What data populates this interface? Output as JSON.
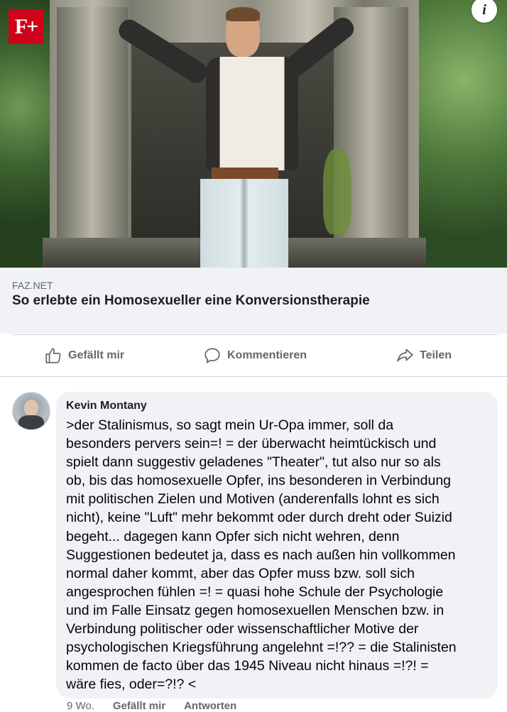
{
  "article": {
    "brand_badge": "F+",
    "info_icon_glyph": "i",
    "domain": "FAZ.NET",
    "title": "So erlebte ein Homosexueller eine Konversionstherapie"
  },
  "actions": {
    "like": "Gefällt mir",
    "comment": "Kommentieren",
    "share": "Teilen"
  },
  "comment": {
    "author": "Kevin Montany",
    "text": ">der Stalinismus, so sagt mein Ur-Opa immer, soll da\nbesonders pervers sein=! = der überwacht heimtückisch und\nspielt dann suggestiv geladenes \"Theater\", tut also  nur so als\nob, bis das homosexuelle Opfer, ins besonderen in Verbindung\nmit politischen Zielen und Motiven (anderenfalls lohnt es sich\nnicht), keine \"Luft\" mehr bekommt oder durch dreht oder Suizid\nbegeht... dagegen kann Opfer sich nicht wehren, denn\nSuggestionen bedeutet ja, dass es nach  außen hin vollkommen\nnormal daher kommt, aber das Opfer muss bzw. soll sich\nangesprochen fühlen =! = quasi hohe Schule der Psychologie\nund im Falle Einsatz gegen homosexuellen Menschen bzw. in\nVerbindung politischer oder wissenschaftlicher Motive der\npsychologischen Kriegsführung angelehnt =!?? = die Stalinisten\nkommen de facto über das 1945 Niveau nicht hinaus =!?! =\nwäre fies, oder=?!? <",
    "time": "9 Wo.",
    "like": "Gefällt mir",
    "reply": "Antworten"
  },
  "colors": {
    "brand_red": "#d0021b",
    "bubble_bg": "#f0f2f5",
    "action_gray": "#65676b"
  }
}
